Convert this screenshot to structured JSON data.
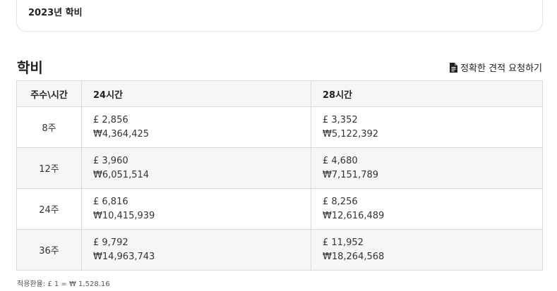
{
  "top_card": {
    "title": "2023년 학비"
  },
  "section": {
    "title": "학비",
    "quote_link": "정확한 견적 요청하기"
  },
  "icons": {
    "quote": "document-icon"
  },
  "table": {
    "headers": [
      "주수\\시간",
      "24시간",
      "28시간"
    ],
    "rows": [
      {
        "weeks": "8주",
        "c24_gbp": "£ 2,856",
        "c24_krw": "₩4,364,425",
        "c28_gbp": "£ 3,352",
        "c28_krw": "₩5,122,392"
      },
      {
        "weeks": "12주",
        "c24_gbp": "£ 3,960",
        "c24_krw": "₩6,051,514",
        "c28_gbp": "£ 4,680",
        "c28_krw": "₩7,151,789"
      },
      {
        "weeks": "24주",
        "c24_gbp": "£ 6,816",
        "c24_krw": "₩10,415,939",
        "c28_gbp": "£ 8,256",
        "c28_krw": "₩12,616,489"
      },
      {
        "weeks": "36주",
        "c24_gbp": "£ 9,792",
        "c24_krw": "₩14,963,743",
        "c28_gbp": "£ 11,952",
        "c28_krw": "₩18,264,568"
      }
    ]
  },
  "footer": {
    "rate_note": "적용환율: £ 1 = ₩ 1,528.16"
  }
}
